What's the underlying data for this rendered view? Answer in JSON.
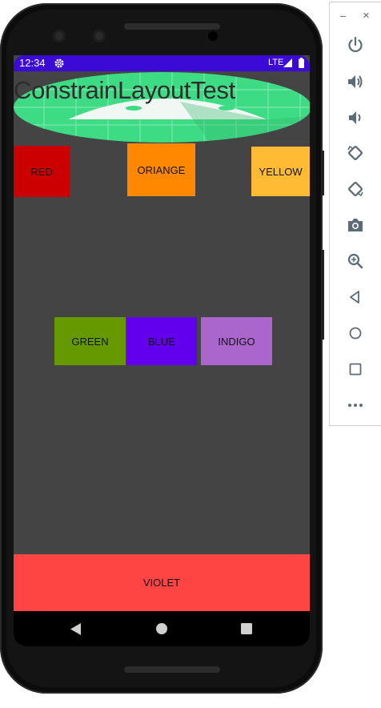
{
  "status_bar": {
    "time": "12:34",
    "network": "LTE",
    "settings_icon": "gear-icon",
    "signal_icon": "signal-icon",
    "battery_icon": "battery-icon"
  },
  "app": {
    "title": "ConstrainLayoutTest",
    "background_color": "#444444"
  },
  "buttons": {
    "red": {
      "label": "RED",
      "color": "#cc0000"
    },
    "orange": {
      "label": "ORIANGE",
      "color": "#ff8800"
    },
    "yellow": {
      "label": "YELLOW",
      "color": "#ffbb33"
    },
    "green": {
      "label": "GREEN",
      "color": "#669900"
    },
    "blue": {
      "label": "BLUE",
      "color": "#6200ee"
    },
    "indigo": {
      "label": "INDIGO",
      "color": "#aa66cc"
    },
    "violet": {
      "label": "VIOLET",
      "color": "#ff4444"
    }
  },
  "nav_bar": {
    "back_icon": "back-triangle-icon",
    "home_icon": "home-circle-icon",
    "recents_icon": "recents-square-icon"
  },
  "emulator_panel": {
    "minimize_label": "–",
    "close_label": "×",
    "tools": [
      "power-icon",
      "volume-up-icon",
      "volume-down-icon",
      "rotate-left-icon",
      "rotate-right-icon",
      "camera-icon",
      "zoom-icon",
      "back-icon",
      "home-icon",
      "overview-icon",
      "more-icon"
    ]
  }
}
